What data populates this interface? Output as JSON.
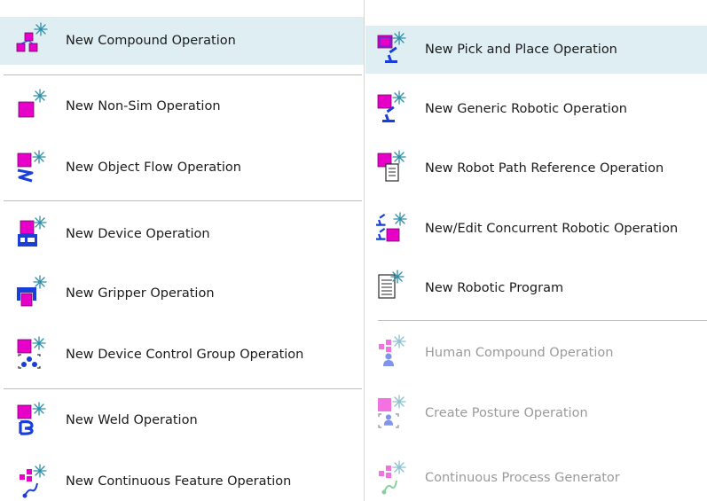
{
  "left_menu": {
    "items": [
      {
        "label": "New Compound Operation",
        "icon": "compound-operation-icon"
      },
      {
        "label": "New Non-Sim Operation",
        "icon": "non-sim-operation-icon"
      },
      {
        "label": "New Object Flow Operation",
        "icon": "object-flow-operation-icon"
      },
      {
        "label": "New Device Operation",
        "icon": "device-operation-icon"
      },
      {
        "label": "New Gripper Operation",
        "icon": "gripper-operation-icon"
      },
      {
        "label": "New Device Control Group Operation",
        "icon": "device-control-group-icon"
      },
      {
        "label": "New Weld Operation",
        "icon": "weld-operation-icon"
      },
      {
        "label": "New Continuous Feature Operation",
        "icon": "continuous-feature-icon"
      }
    ]
  },
  "right_menu": {
    "items": [
      {
        "label": "New Pick and Place Operation",
        "icon": "pick-and-place-icon"
      },
      {
        "label": "New Generic Robotic Operation",
        "icon": "generic-robotic-icon"
      },
      {
        "label": "New Robot Path Reference Operation",
        "icon": "robot-path-reference-icon"
      },
      {
        "label": "New/Edit Concurrent Robotic Operation",
        "icon": "concurrent-robotic-icon"
      },
      {
        "label": "New Robotic Program",
        "icon": "robotic-program-icon"
      },
      {
        "label": "Human Compound Operation",
        "icon": "human-compound-icon"
      },
      {
        "label": "Create Posture Operation",
        "icon": "posture-operation-icon"
      },
      {
        "label": "Continuous Process Generator",
        "icon": "continuous-process-icon"
      }
    ]
  },
  "colors": {
    "highlight": "#dfeef2",
    "magenta": "#e600c8",
    "blue": "#1a3fd6",
    "spark": "#2f8fa8",
    "disabled_text": "#9a9a9a"
  }
}
